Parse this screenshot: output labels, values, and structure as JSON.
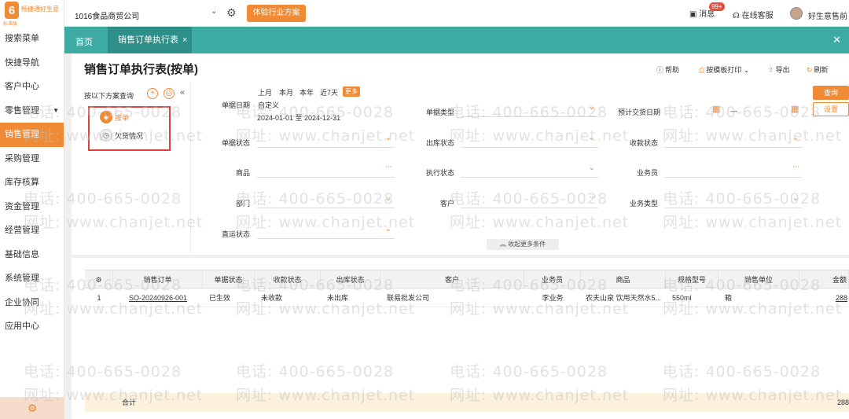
{
  "sidebar": {
    "logo_brand": "畅捷通好生意",
    "logo_edition": "标准版",
    "items": [
      {
        "label": "搜索菜单"
      },
      {
        "label": "快捷导航"
      },
      {
        "label": "客户中心"
      },
      {
        "label": "零售管理"
      },
      {
        "label": "销售管理"
      },
      {
        "label": "采购管理"
      },
      {
        "label": "库存核算"
      },
      {
        "label": "资金管理"
      },
      {
        "label": "经营管理"
      },
      {
        "label": "基础信息"
      },
      {
        "label": "系统管理"
      },
      {
        "label": "企业协同"
      },
      {
        "label": "应用中心"
      }
    ],
    "active_index": 4
  },
  "header": {
    "company": "1016食品商贸公司",
    "trial_label": "体验行业方案",
    "messages_label": "消息",
    "messages_badge": "99+",
    "service_label": "在线客服",
    "username": "好生意售前"
  },
  "tabs": {
    "home_label": "首页",
    "active_label": "销售订单执行表"
  },
  "page": {
    "title": "销售订单执行表(按单)",
    "help_label": "帮助",
    "print_label": "按模板打印",
    "export_label": "导出",
    "refresh_label": "刷新"
  },
  "scheme": {
    "title": "按以下方案查询",
    "items": [
      {
        "label": "按单"
      },
      {
        "label": "欠货情况"
      }
    ]
  },
  "filters": {
    "quick_dates": [
      "上月",
      "本月",
      "本年",
      "近7天"
    ],
    "more_label": "更多",
    "date_mode": "自定义",
    "date_range": "2024-01-01 至 2024-12-31",
    "labels": {
      "doc_date": "单据日期",
      "doc_type": "单据类型",
      "delivery_date": "预计交货日期",
      "doc_status": "单据状态",
      "outbound_status": "出库状态",
      "receipt_status": "收款状态",
      "product": "商品",
      "exec_status": "执行状态",
      "salesperson": "业务员",
      "department": "部门",
      "customer": "客户",
      "business_type": "业务类型",
      "direct_status": "直运状态"
    },
    "collapse_label": "收起更多条件",
    "query_label": "查询",
    "settings_label": "设置"
  },
  "table": {
    "columns": [
      "销售订单",
      "单据状态",
      "收款状态",
      "出库状态",
      "客户",
      "业务员",
      "商品",
      "规格型号",
      "销售单位",
      "金额"
    ],
    "rows": [
      {
        "index": "1",
        "order_no": "SO-20240926-001",
        "doc_status": "已生效",
        "receipt_status": "未收款",
        "outbound_status": "未出库",
        "customer": "联易批发公司",
        "salesperson": "李业务",
        "product": "农夫山泉 饮用天然水5...",
        "spec": "550ml",
        "unit": "箱",
        "amount": "288"
      }
    ],
    "summary_label": "合计",
    "summary_amount": "288"
  },
  "watermark": {
    "phone": "电话: 400-665-0028",
    "site": "网址: www.chanjet.net"
  },
  "colors": {
    "accent": "#f08a35",
    "tab_teal": "#3eaba2",
    "highlight_box": "#e0413a"
  }
}
